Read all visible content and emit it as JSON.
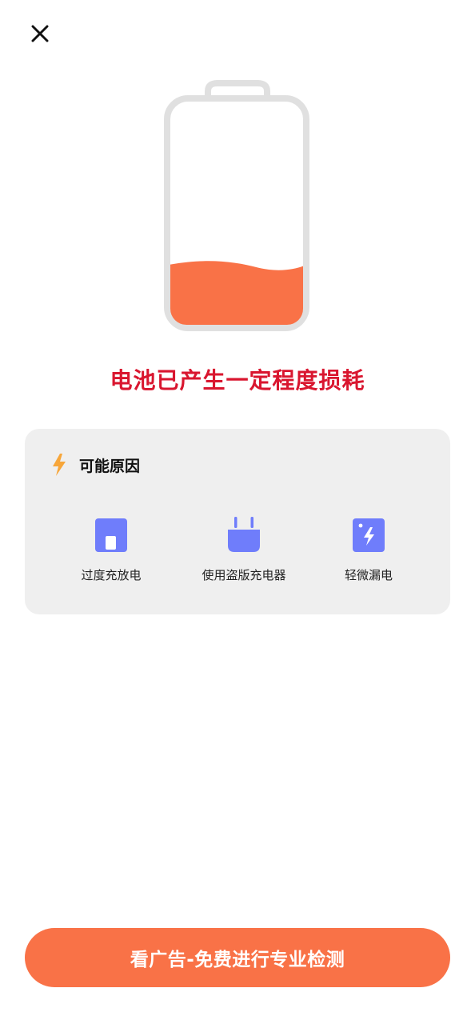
{
  "close_icon": "close-icon",
  "battery": {
    "level_fraction": 0.27,
    "fill_color": "#f97247",
    "frame_color": "#e0e0e0"
  },
  "headline": "电池已产生一定程度损耗",
  "reasons": {
    "title": "可能原因",
    "title_icon": "lightning-icon",
    "items": [
      {
        "label": "过度充放电",
        "icon": "battery-cell-icon"
      },
      {
        "label": "使用盗版充电器",
        "icon": "charger-plug-icon"
      },
      {
        "label": "轻微漏电",
        "icon": "leakage-bolt-icon"
      }
    ]
  },
  "cta": {
    "label": "看广告-免费进行专业检测"
  },
  "colors": {
    "accent": "#f97247",
    "headline": "#d9162f",
    "icon_blue": "#6f7dfb",
    "bolt_orange": "#f7a63a",
    "card_bg": "#efefef"
  }
}
